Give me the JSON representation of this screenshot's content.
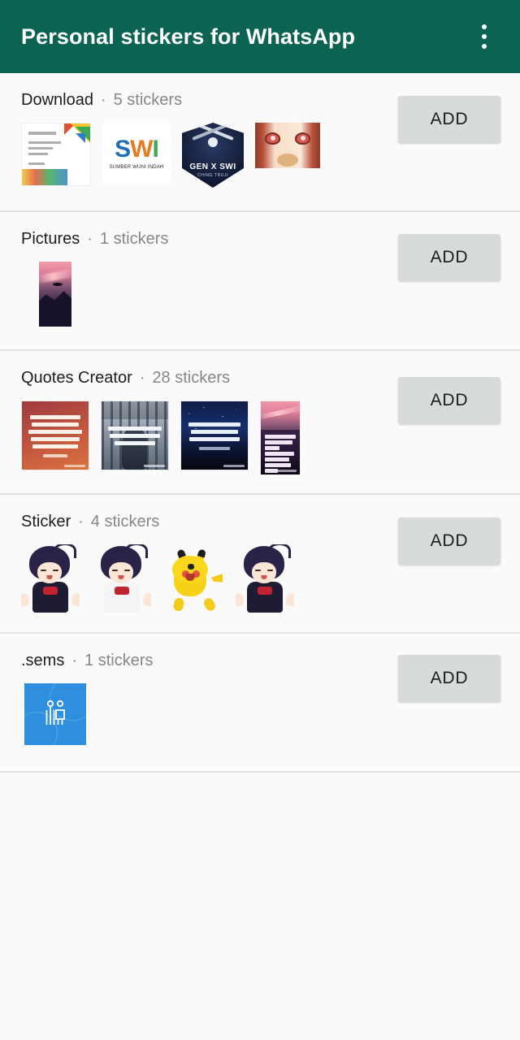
{
  "appbar": {
    "title": "Personal stickers for WhatsApp",
    "overflow_icon": "more-vert-icon",
    "background_color": "#0d6352",
    "title_color": "#ffffff"
  },
  "theme": {
    "page_background": "#fafafa",
    "divider_color": "#e2e2e2",
    "add_button_bg": "#d7dbdb",
    "add_button_text_color": "#1c1c1c",
    "pack_name_color": "#1d1d1d",
    "pack_count_color": "#878787"
  },
  "separator": "·",
  "packs": [
    {
      "name": "Download",
      "count_label": "5 stickers",
      "add_label": "ADD",
      "thumbs": [
        {
          "kind": "doc",
          "alt": "letterhead-document-thumbnail"
        },
        {
          "kind": "swi",
          "alt": "swi-logo-thumbnail",
          "mark_s": "S",
          "mark_w": "W",
          "mark_i": "I",
          "subtitle": "SUMBER WUNI INDAH"
        },
        {
          "kind": "badge",
          "alt": "gen-x-swi-badge-thumbnail",
          "line1": "GEN X SWI",
          "line2": "CHING TRUJI"
        },
        {
          "kind": "face",
          "alt": "anime-face-closeup-thumbnail"
        }
      ]
    },
    {
      "name": "Pictures",
      "count_label": "1 stickers",
      "add_label": "ADD",
      "thumbs": [
        {
          "kind": "sunset",
          "alt": "pink-sunset-mountain-thumbnail"
        }
      ]
    },
    {
      "name": "Quotes Creator",
      "count_label": "28 stickers",
      "add_label": "ADD",
      "thumbs": [
        {
          "kind": "quote1",
          "alt": "quote-card-red-thumbnail"
        },
        {
          "kind": "quote2",
          "alt": "quote-card-gate-thumbnail"
        },
        {
          "kind": "quote3",
          "alt": "quote-card-starry-night-thumbnail"
        },
        {
          "kind": "quote4",
          "alt": "quote-card-sunset-thumbnail"
        }
      ]
    },
    {
      "name": "Sticker",
      "count_label": "4 stickers",
      "add_label": "ADD",
      "thumbs": [
        {
          "kind": "anime-dark",
          "alt": "anime-girl-sticker-thumbnail"
        },
        {
          "kind": "anime-white",
          "alt": "anime-girl-winking-sticker-thumbnail"
        },
        {
          "kind": "pikachu",
          "alt": "pikachu-sticker-thumbnail"
        },
        {
          "kind": "anime-dark2",
          "alt": "anime-girl-peace-sticker-thumbnail"
        }
      ]
    },
    {
      "name": ".sems",
      "count_label": "1 stickers",
      "add_label": "ADD",
      "thumbs": [
        {
          "kind": "sems",
          "alt": "blue-people-icon-thumbnail"
        }
      ]
    }
  ]
}
